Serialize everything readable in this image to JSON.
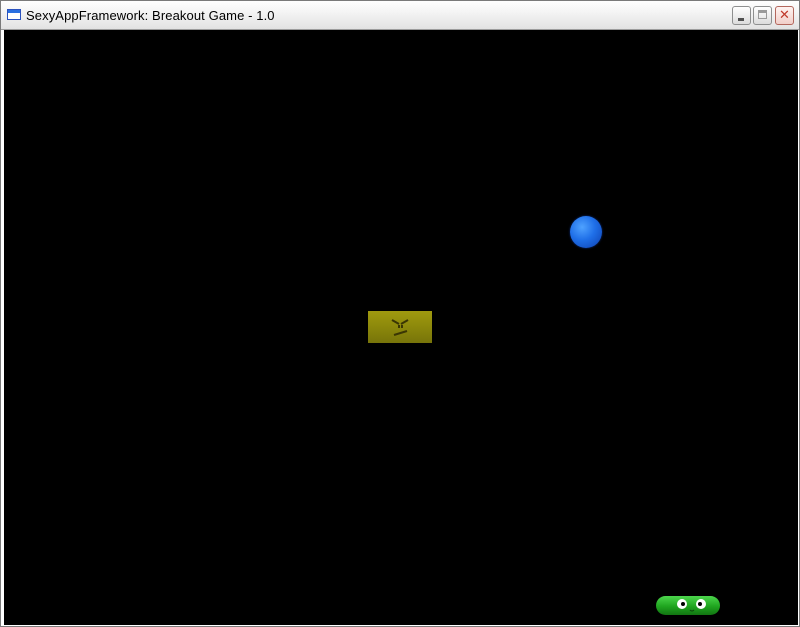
{
  "window": {
    "title": "SexyAppFramework: Breakout Game - 1.0",
    "icon": "app-window-icon",
    "controls": {
      "minimize_icon": "minimize-icon",
      "maximize_icon": "maximize-icon",
      "close_icon": "close-icon",
      "close_glyph": "✕"
    }
  },
  "game": {
    "background_color": "#000000",
    "ball": {
      "color": "#1f6fe8",
      "icon": "ball-sprite"
    },
    "brick": {
      "color": "#8c880b",
      "face": "angry-face-icon"
    },
    "paddle": {
      "color": "#1fa51f",
      "face": "googly-eyes-icon"
    }
  }
}
